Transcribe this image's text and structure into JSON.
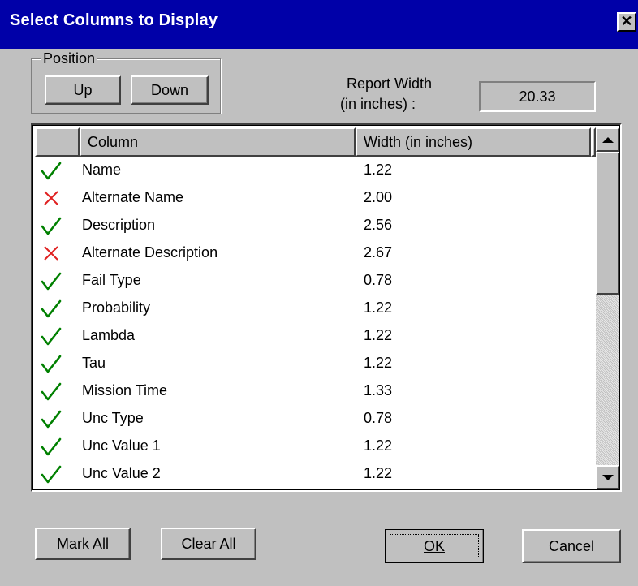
{
  "window": {
    "title": "Select Columns to Display",
    "close_label": "✕"
  },
  "position": {
    "legend": "Position",
    "up_label": "Up",
    "down_label": "Down"
  },
  "report_width": {
    "label_line1": "Report Width",
    "label_line2": "(in inches) :",
    "value": "20.33"
  },
  "table": {
    "headers": {
      "mark": "",
      "column": "Column",
      "width": "Width (in inches)"
    },
    "rows": [
      {
        "checked": true,
        "name": "Name",
        "width": "1.22"
      },
      {
        "checked": false,
        "name": "Alternate Name",
        "width": "2.00"
      },
      {
        "checked": true,
        "name": "Description",
        "width": "2.56"
      },
      {
        "checked": false,
        "name": "Alternate Description",
        "width": "2.67"
      },
      {
        "checked": true,
        "name": "Fail Type",
        "width": "0.78"
      },
      {
        "checked": true,
        "name": "Probability",
        "width": "1.22"
      },
      {
        "checked": true,
        "name": "Lambda",
        "width": "1.22"
      },
      {
        "checked": true,
        "name": "Tau",
        "width": "1.22"
      },
      {
        "checked": true,
        "name": "Mission Time",
        "width": "1.33"
      },
      {
        "checked": true,
        "name": "Unc Type",
        "width": "0.78"
      },
      {
        "checked": true,
        "name": "Unc Value 1",
        "width": "1.22"
      },
      {
        "checked": true,
        "name": "Unc Value 2",
        "width": "1.22"
      }
    ]
  },
  "buttons": {
    "mark_all": "Mark All",
    "clear_all": "Clear All",
    "ok": "OK",
    "cancel": "Cancel"
  },
  "colors": {
    "title_bg": "#0000a8",
    "check": "#008000",
    "cross": "#e02020",
    "face": "#c0c0c0"
  },
  "icons": {
    "checked": "check-icon",
    "unchecked": "cross-icon"
  }
}
